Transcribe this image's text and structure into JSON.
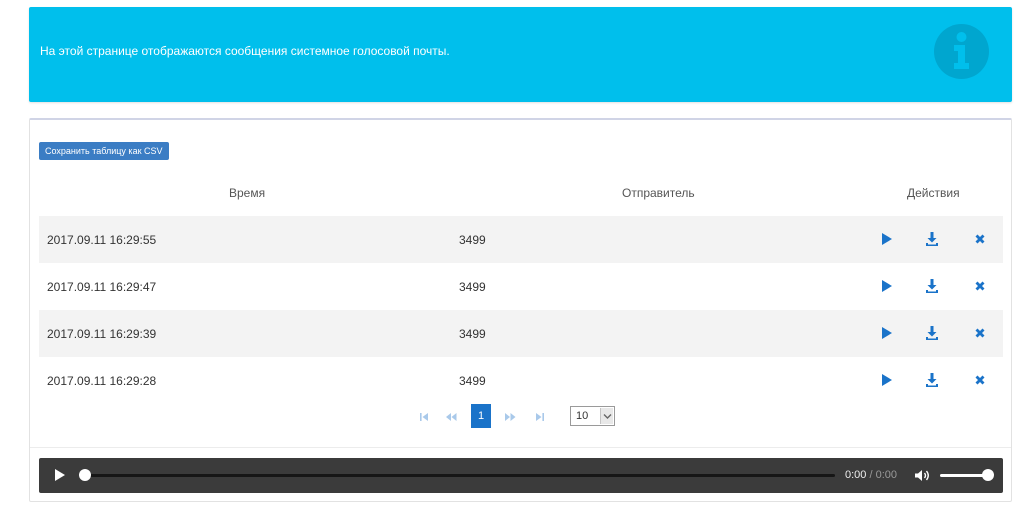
{
  "banner": {
    "message": "На этой странице отображаются сообщения системное голосовой почты.",
    "icon": "info-circle-icon",
    "color": "#00bfec"
  },
  "toolbar": {
    "csv_label": "Сохранить таблицу как CSV"
  },
  "table": {
    "columns": [
      "Время",
      "Отправитель",
      "Действия"
    ],
    "rows": [
      {
        "time": "2017.09.11 16:29:55",
        "sender": "3499"
      },
      {
        "time": "2017.09.11 16:29:47",
        "sender": "3499"
      },
      {
        "time": "2017.09.11 16:29:39",
        "sender": "3499"
      },
      {
        "time": "2017.09.11 16:29:28",
        "sender": "3499"
      }
    ],
    "row_actions": [
      "play-icon",
      "download-icon",
      "delete-icon"
    ],
    "action_color": "#1a73c9"
  },
  "pagination": {
    "current_page": "1",
    "page_size": "10",
    "icons": [
      "first-page-icon",
      "prev-page-icon",
      "next-page-icon",
      "last-page-icon"
    ]
  },
  "player": {
    "current_time": "0:00",
    "separator": " / ",
    "duration": "0:00",
    "progress": 0,
    "volume": 1.0
  }
}
